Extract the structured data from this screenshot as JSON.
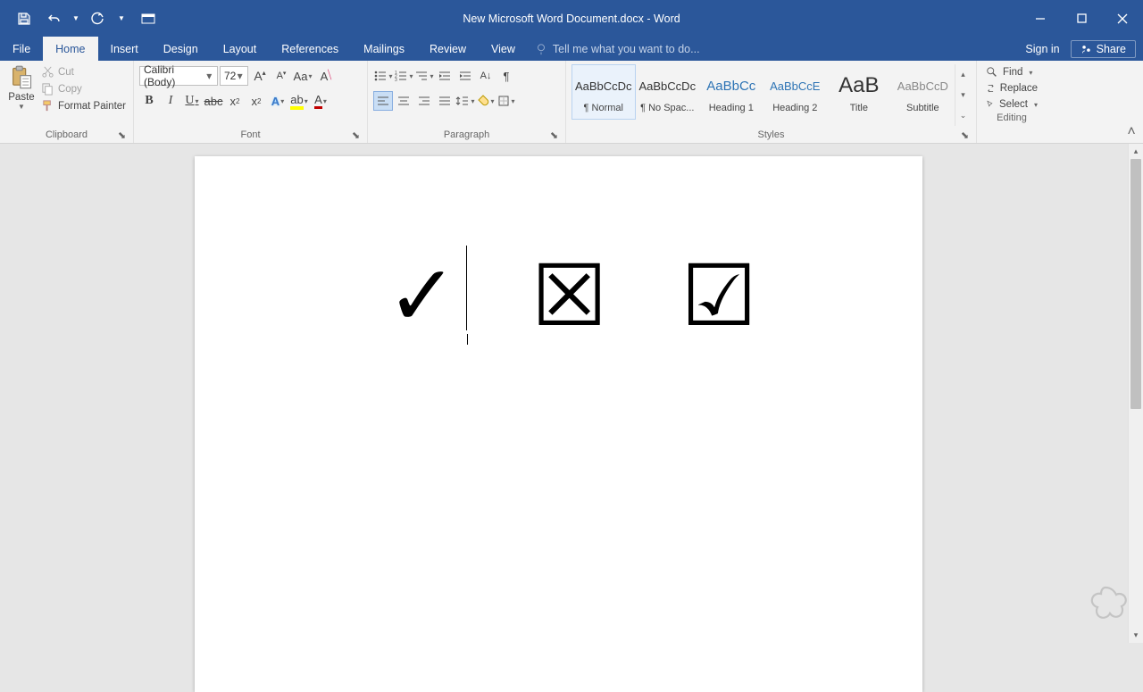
{
  "title": "New Microsoft Word Document.docx - Word",
  "tabs": {
    "file": "File",
    "home": "Home",
    "insert": "Insert",
    "design": "Design",
    "layout": "Layout",
    "references": "References",
    "mailings": "Mailings",
    "review": "Review",
    "view": "View"
  },
  "tellme_placeholder": "Tell me what you want to do...",
  "signin": "Sign in",
  "share": "Share",
  "clipboard": {
    "paste": "Paste",
    "cut": "Cut",
    "copy": "Copy",
    "format_painter": "Format Painter",
    "label": "Clipboard"
  },
  "font": {
    "name": "Calibri (Body)",
    "size": "72",
    "label": "Font"
  },
  "paragraph": {
    "label": "Paragraph"
  },
  "styles": {
    "label": "Styles",
    "items": [
      {
        "preview": "AaBbCcDc",
        "name": "¶ Normal"
      },
      {
        "preview": "AaBbCcDc",
        "name": "¶ No Spac..."
      },
      {
        "preview": "AaBbCc",
        "name": "Heading 1"
      },
      {
        "preview": "AaBbCcE",
        "name": "Heading 2"
      },
      {
        "preview": "AaB",
        "name": "Title"
      },
      {
        "preview": "AaBbCcD",
        "name": "Subtitle"
      }
    ]
  },
  "editing": {
    "find": "Find",
    "replace": "Replace",
    "select": "Select",
    "label": "Editing"
  },
  "document_symbols": "✓ ☒ ☑"
}
